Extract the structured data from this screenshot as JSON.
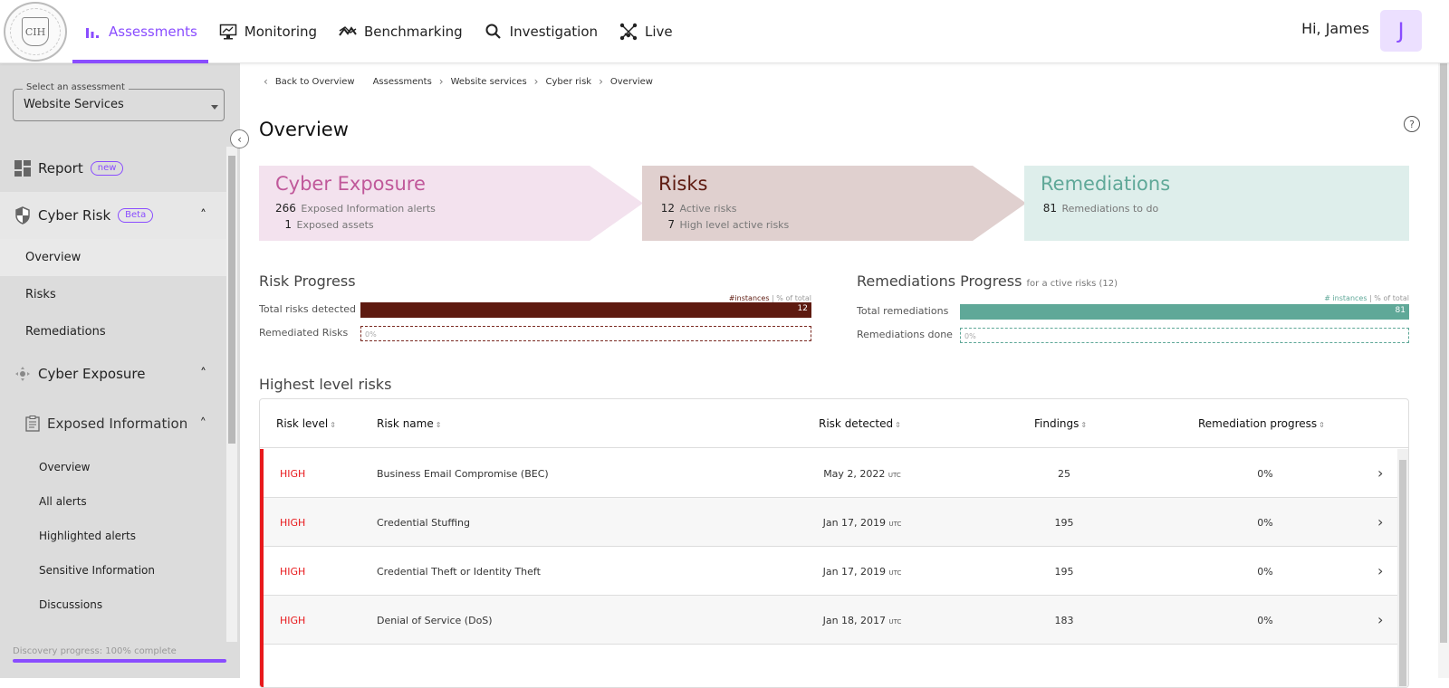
{
  "nav": {
    "logo_text": "CIH",
    "items": [
      {
        "label": "Assessments",
        "icon": "bar-chart-icon",
        "active": true
      },
      {
        "label": "Monitoring",
        "icon": "monitor-chart-icon",
        "active": false
      },
      {
        "label": "Benchmarking",
        "icon": "trend-icon",
        "active": false
      },
      {
        "label": "Investigation",
        "icon": "search-icon",
        "active": false
      },
      {
        "label": "Live",
        "icon": "network-icon",
        "active": false
      }
    ],
    "greeting": "Hi, James",
    "avatar_initial": "J"
  },
  "sidebar": {
    "select_label": "Select an assessment",
    "select_value": "Website Services",
    "report": {
      "label": "Report",
      "badge": "new"
    },
    "cyber_risk": {
      "label": "Cyber Risk",
      "badge": "Beta",
      "items": [
        "Overview",
        "Risks",
        "Remediations"
      ]
    },
    "cyber_exposure": {
      "label": "Cyber Exposure"
    },
    "exposed_information": {
      "label": "Exposed Information",
      "items": [
        "Overview",
        "All alerts",
        "Highlighted alerts",
        "Sensitive Information",
        "Discussions"
      ]
    },
    "discovery_progress": "Discovery progress: 100% complete",
    "discovery_percent": 100
  },
  "breadcrumb": {
    "back": "Back to Overview",
    "items": [
      "Assessments",
      "Website services",
      "Cyber risk",
      "Overview"
    ]
  },
  "page_title": "Overview",
  "stages": {
    "exposure": {
      "title": "Cyber Exposure",
      "lines": [
        {
          "n": "266",
          "t": "Exposed Information alerts"
        },
        {
          "n": "1",
          "t": "Exposed assets"
        }
      ]
    },
    "risks": {
      "title": "Risks",
      "lines": [
        {
          "n": "12",
          "t": "Active risks"
        },
        {
          "n": "7",
          "t": "High level active risks"
        }
      ]
    },
    "remediations": {
      "title": "Remediations",
      "lines": [
        {
          "n": "81",
          "t": "Remediations to do"
        }
      ]
    }
  },
  "risk_progress": {
    "title": "Risk Progress",
    "legend_instances": "#instances",
    "legend_total": "% of total",
    "total_label": "Total risks detected",
    "total_value": "12",
    "done_label": "Remediated Risks",
    "done_value": "0%",
    "color": "#5e1a10"
  },
  "rem_progress": {
    "title": "Remediations Progress",
    "subtitle": "for a ctive risks (12)",
    "legend_instances": "# instances",
    "legend_total": "% of total",
    "total_label": "Total remediations",
    "total_value": "81",
    "done_label": "Remediations done",
    "done_value": "0%",
    "color": "#5fa898"
  },
  "table": {
    "title": "Highest level risks",
    "columns": [
      "Risk level",
      "Risk name",
      "Risk detected",
      "Findings",
      "Remediation progress"
    ],
    "tz": "UTC",
    "rows": [
      {
        "level": "HIGH",
        "name": "Business Email Compromise (BEC)",
        "date": "May 2, 2022",
        "findings": "25",
        "progress": "0%"
      },
      {
        "level": "HIGH",
        "name": "Credential Stuffing",
        "date": "Jan 17, 2019",
        "findings": "195",
        "progress": "0%"
      },
      {
        "level": "HIGH",
        "name": "Credential Theft or Identity Theft",
        "date": "Jan 17, 2019",
        "findings": "195",
        "progress": "0%"
      },
      {
        "level": "HIGH",
        "name": "Denial of Service (DoS)",
        "date": "Jan 18, 2017",
        "findings": "183",
        "progress": "0%"
      }
    ]
  }
}
